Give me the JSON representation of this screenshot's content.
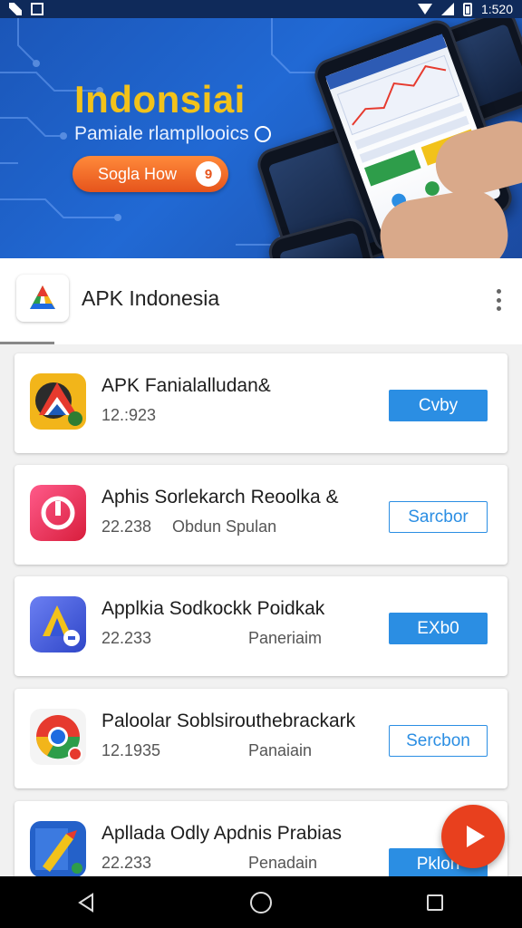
{
  "status_bar": {
    "time": "1:520",
    "left_icons": [
      "notification-icon",
      "gallery-icon"
    ],
    "right_icons": [
      "wifi-icon",
      "signal-icon",
      "battery-icon"
    ]
  },
  "banner": {
    "title": "Indonsiai",
    "subtitle": "Pamiale rlampllooics",
    "button_label": "Sogla How",
    "button_badge": "9"
  },
  "header": {
    "app_title": "APK Indonesia",
    "logo": "apk-logo-icon",
    "menu": "more-vert-icon"
  },
  "apps": [
    {
      "name": "APK Fanialalludan&",
      "meta": "12.:923",
      "tag": "",
      "button": "Cvby",
      "button_style": "filled",
      "icon": "app-icon-1",
      "colors": [
        "#2b2b2b",
        "#e63a2e",
        "#f2b51a",
        "#2e7d32",
        "#1e5bb8"
      ]
    },
    {
      "name": "Aphis Sorlekarch Reoolka &",
      "meta": "22.238",
      "tag": "Obdun  Spulan",
      "button": "Sarcbor",
      "button_style": "outline",
      "icon": "app-icon-2",
      "colors": [
        "#e2304f",
        "#ff5a8a"
      ]
    },
    {
      "name": "Applkia Sodkockk Poidkak",
      "meta": "22.233",
      "tag": "Paneriaim",
      "button": "EXb0",
      "button_style": "filled",
      "icon": "app-icon-3",
      "colors": [
        "#3656d6",
        "#6b7ff2",
        "#f2c21a"
      ]
    },
    {
      "name": "Paloolar Soblsiroutheb​rackark",
      "meta": "12.1935",
      "tag": "Panaiain",
      "button": "Sercbon",
      "button_style": "outline",
      "icon": "app-icon-4",
      "colors": [
        "#e63a2e",
        "#2e9d4a",
        "#f2b51a",
        "#1e6be0"
      ]
    },
    {
      "name": "Apllada Odly Apdnis Prabias",
      "meta": "22.233",
      "tag": "Penadain",
      "button": "Pklon",
      "button_style": "filled",
      "icon": "app-icon-5",
      "colors": [
        "#2461c9",
        "#f2c21a",
        "#e63a2e"
      ]
    }
  ],
  "fab": {
    "icon": "play-icon"
  },
  "nav_bar": {
    "buttons": [
      "back-icon",
      "home-icon",
      "recents-icon"
    ]
  }
}
